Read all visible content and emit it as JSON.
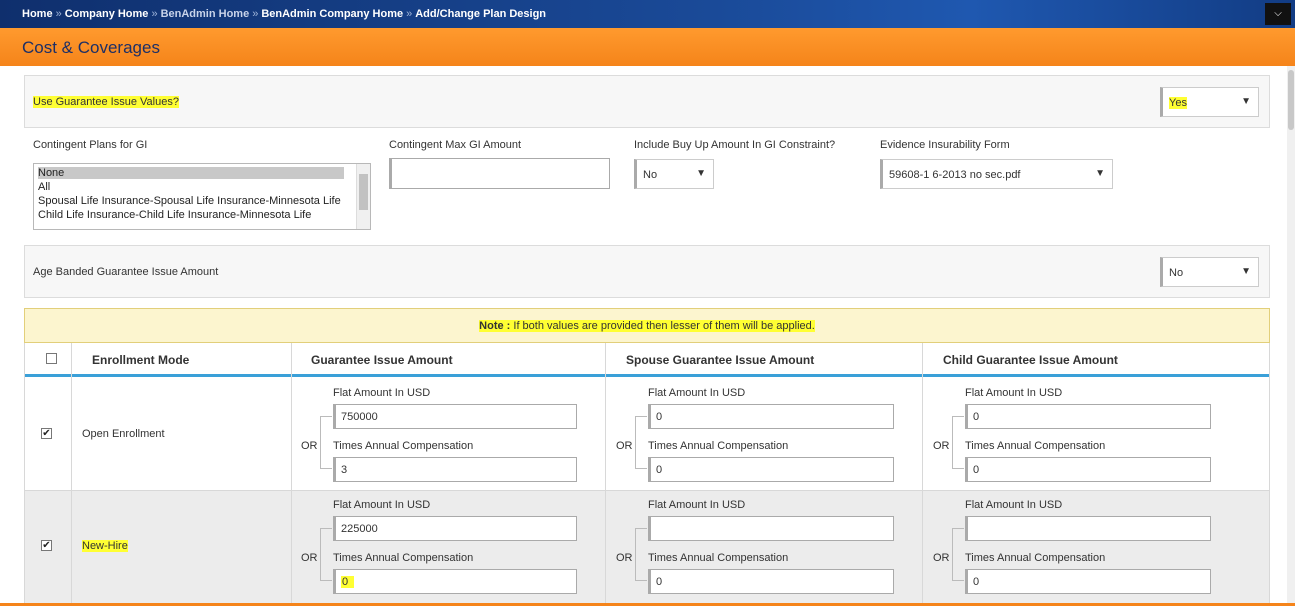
{
  "breadcrumb": {
    "items": [
      "Home",
      "Company Home",
      "BenAdmin Home",
      "BenAdmin Company Home",
      "Add/Change Plan Design"
    ],
    "separator": "»"
  },
  "header": {
    "title": "Cost & Coverages"
  },
  "corner_icon": "chevron-down-icon",
  "guarantee": {
    "label": "Use Guarantee Issue Values?",
    "value": "Yes"
  },
  "fields": {
    "contingent_plans_label": "Contingent Plans for GI",
    "contingent_plans_options": [
      "None",
      "All",
      "Spousal Life Insurance-Spousal Life Insurance-Minnesota Life",
      "Child Life Insurance-Child Life Insurance-Minnesota Life"
    ],
    "contingent_plans_selected": "None",
    "contingent_max_label": "Contingent Max GI Amount",
    "contingent_max_value": "",
    "buy_up_label": "Include Buy Up Amount In GI Constraint?",
    "buy_up_value": "No",
    "evidence_label": "Evidence Insurability Form",
    "evidence_value": "59608-1 6-2013 no sec.pdf"
  },
  "age_banded": {
    "label": "Age Banded Guarantee Issue Amount",
    "value": "No"
  },
  "note": {
    "bold": "Note :",
    "text": "If both values are provided then lesser of them will be applied."
  },
  "table": {
    "headers": {
      "mode": "Enrollment Mode",
      "gi": "Guarantee Issue Amount",
      "spouse": "Spouse Guarantee Issue Amount",
      "child": "Child Guarantee Issue Amount"
    },
    "flat_label": "Flat Amount In USD",
    "times_label": "Times Annual Compensation",
    "or_label": "OR",
    "rows": [
      {
        "mode": "Open Enrollment",
        "checked": true,
        "check_glyph": "✔",
        "gi_flat": "750000",
        "gi_times": "3",
        "spouse_flat": "0",
        "spouse_times": "0",
        "child_flat": "0",
        "child_times": "0"
      },
      {
        "mode": "New-Hire",
        "checked": true,
        "check_glyph": "✔",
        "gi_flat": "225000",
        "gi_times": "0",
        "spouse_flat": "",
        "spouse_times": "0",
        "child_flat": "",
        "child_times": "0"
      }
    ]
  },
  "colors": {
    "accent": "#f5841a",
    "nav": "#1a4a98",
    "highlight": "#ffff33",
    "table_rule": "#3aa0d8"
  }
}
